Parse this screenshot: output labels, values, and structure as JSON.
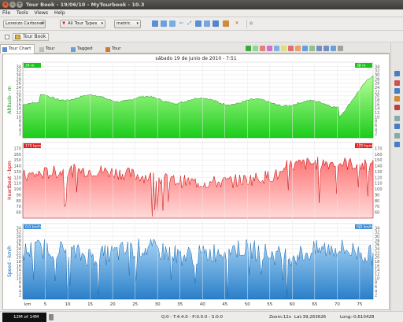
{
  "window": {
    "title": "Tour Book - 19/06/10 - MyTourbook - 10.3"
  },
  "menu": [
    "File",
    "Tools",
    "Views",
    "Help"
  ],
  "toolbar": {
    "person": "Lorenzo Carbonell",
    "tour_types": "All Tour Types",
    "measurement": "metric"
  },
  "bookbar": {
    "tab": "Tour Book"
  },
  "tabs": [
    {
      "label": "Tour Chart"
    },
    {
      "label": "Tour Editor"
    },
    {
      "label": "Tagged Tours"
    },
    {
      "label": "Tour Analyzer"
    }
  ],
  "chart": {
    "date_title": "sábado 19 de junio de 2010 - 7:51",
    "x_unit": "km",
    "x_ticks": [
      "5",
      "10",
      "15",
      "20",
      "25",
      "30",
      "35",
      "40",
      "45",
      "50",
      "55",
      "60",
      "65",
      "70",
      "75"
    ],
    "panels": [
      {
        "ylabel": "Altitude - m",
        "yticks": [
          "2",
          "4",
          "6",
          "8",
          "10",
          "12",
          "14",
          "16",
          "18",
          "20",
          "22",
          "24",
          "26",
          "28",
          "30",
          "32",
          "34"
        ],
        "badge_left": "34 m",
        "badge_right": "34 m",
        "fill_top": "#b8ff9a",
        "fill_bottom": "#1bcc1b",
        "stroke": "#138a13",
        "badge_color": "#18c418"
      },
      {
        "ylabel": "Heartbeat - bpm",
        "yticks": [
          "60",
          "70",
          "80",
          "90",
          "100",
          "110",
          "120",
          "130",
          "140",
          "150",
          "160",
          "170"
        ],
        "badge_left": "170 bpm",
        "badge_right": "170 bpm",
        "fill_top": "#ff7070",
        "fill_bottom": "#ffdada",
        "stroke": "#c40000",
        "badge_color": "#e02020"
      },
      {
        "ylabel": "Speed - km/h",
        "yticks": [
          "2",
          "4",
          "6",
          "8",
          "10",
          "12",
          "14",
          "16",
          "18",
          "20",
          "22",
          "24",
          "26",
          "28",
          "30",
          "32",
          "34"
        ],
        "badge_left": "0,0 km/h",
        "badge_right": "0,0 km/h",
        "fill_top": "#a8d4f5",
        "fill_bottom": "#2a7fc9",
        "stroke": "#1466b0",
        "badge_color": "#3b8fd6"
      }
    ]
  },
  "status": {
    "memory": "12M of 14M",
    "position": "Q:0 - T:4.4.0 - P:0.0.0 - S:0.0",
    "zoom": "Zoom:12x",
    "lat": "Lat:39,263626",
    "long": "Long:-0,610428"
  }
}
